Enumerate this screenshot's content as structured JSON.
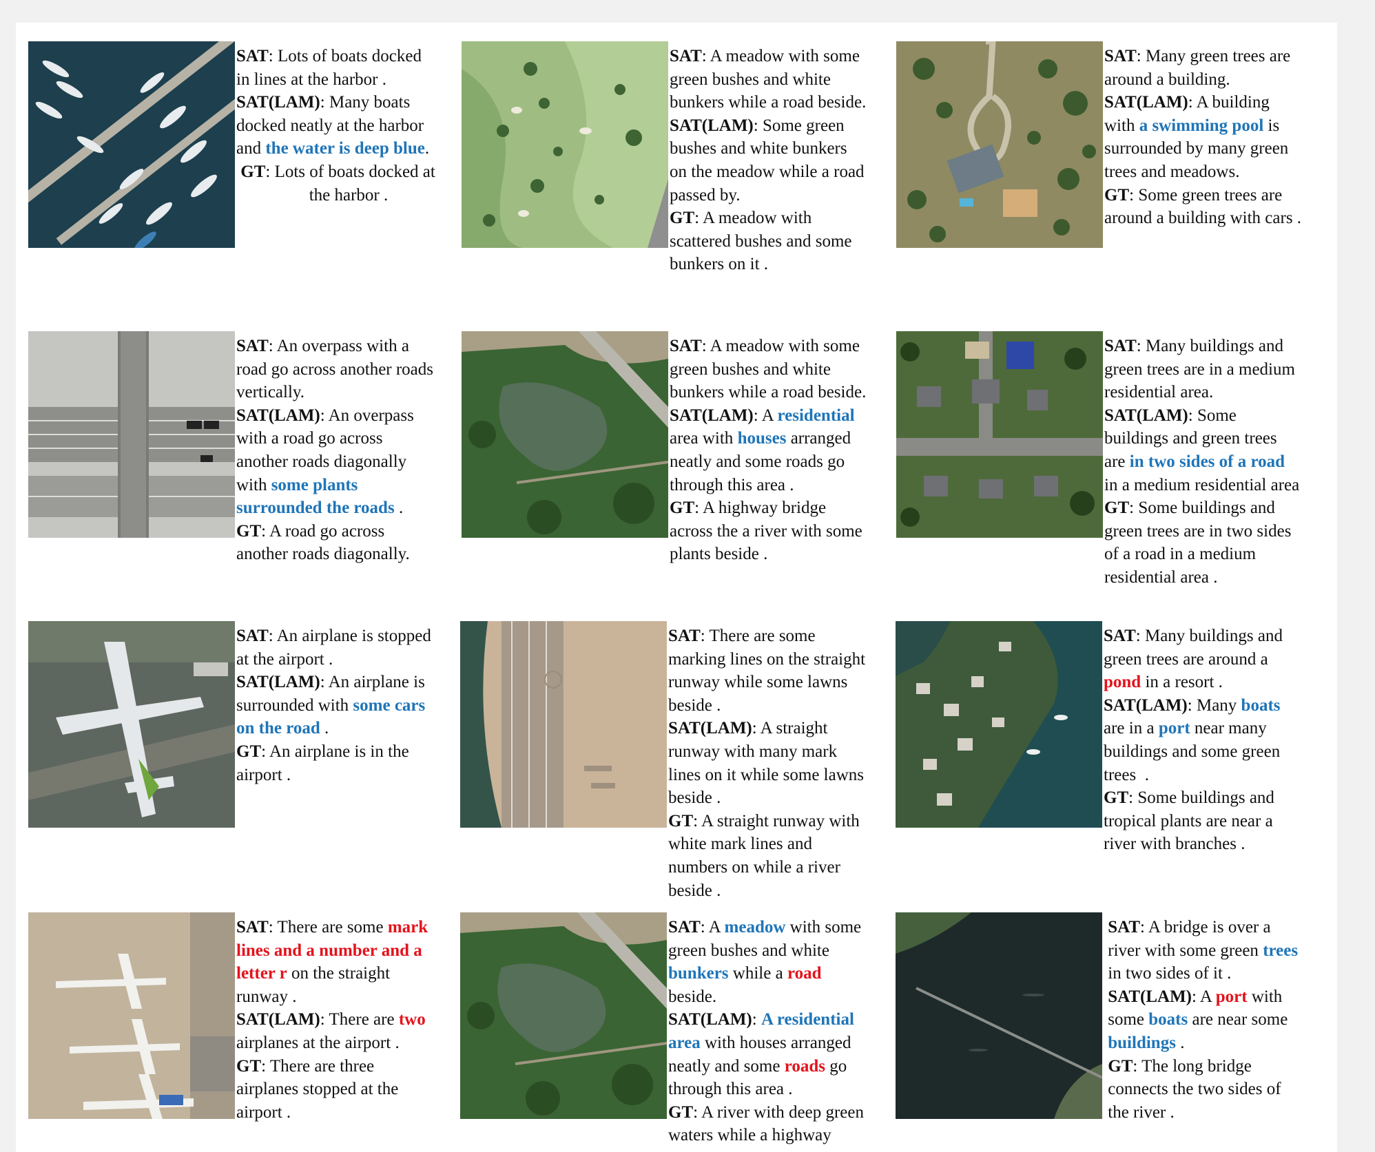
{
  "image_colors": {
    "water": "#1d3f4e",
    "grass": "#9fbd82",
    "forest": "#2f5a2b",
    "road": "#9a9a9a",
    "tarmac": "#c9b49a",
    "dark_water": "#1e2a2a"
  },
  "highlight_colors": {
    "blue": "#1f75b8",
    "red": "#e3131c"
  },
  "examples": [
    {
      "image": "harbor-boats",
      "lines": [
        [
          [
            "b",
            "SAT"
          ],
          [
            "t",
            ": Lots of boats docked"
          ]
        ],
        [
          [
            "t",
            "in lines at the harbor ."
          ]
        ],
        [
          [
            "b",
            "SAT(LAM)"
          ],
          [
            "t",
            ": Many boats"
          ]
        ],
        [
          [
            "t",
            "docked neatly at the harbor"
          ]
        ],
        [
          [
            "t",
            "and "
          ],
          [
            "blue",
            "the water is deep blue"
          ],
          [
            "t",
            "."
          ]
        ],
        [
          [
            "t",
            " "
          ],
          [
            "b",
            "GT"
          ],
          [
            "t",
            ": Lots of boats docked at"
          ]
        ],
        [
          [
            "c",
            "the harbor ."
          ]
        ]
      ]
    },
    {
      "image": "golf-meadow",
      "lines": [
        [
          [
            "b",
            "SAT"
          ],
          [
            "t",
            ": A meadow with some"
          ]
        ],
        [
          [
            "t",
            "green bushes and white"
          ]
        ],
        [
          [
            "t",
            "bunkers while a road beside."
          ]
        ],
        [
          [
            "b",
            "SAT(LAM)"
          ],
          [
            "t",
            ": Some green"
          ]
        ],
        [
          [
            "t",
            "bushes and white bunkers"
          ]
        ],
        [
          [
            "t",
            "on the meadow while a road"
          ]
        ],
        [
          [
            "t",
            "passed by."
          ]
        ],
        [
          [
            "b",
            "GT"
          ],
          [
            "t",
            ": A meadow with"
          ]
        ],
        [
          [
            "t",
            "scattered bushes and some"
          ]
        ],
        [
          [
            "t",
            "bunkers on it ."
          ]
        ]
      ]
    },
    {
      "image": "house-pool",
      "lines": [
        [
          [
            "b",
            "SAT"
          ],
          [
            "t",
            ": Many green trees are"
          ]
        ],
        [
          [
            "t",
            "around a building."
          ]
        ],
        [
          [
            "b",
            "SAT(LAM)"
          ],
          [
            "t",
            ": A building"
          ]
        ],
        [
          [
            "t",
            "with "
          ],
          [
            "blue",
            "a swimming pool"
          ],
          [
            "t",
            " is"
          ]
        ],
        [
          [
            "t",
            "surrounded by many green"
          ]
        ],
        [
          [
            "t",
            "trees and meadows."
          ]
        ],
        [
          [
            "b",
            "GT"
          ],
          [
            "t",
            ": Some green trees are"
          ]
        ],
        [
          [
            "t",
            "around a building with cars ."
          ]
        ]
      ]
    },
    {
      "image": "overpass",
      "lines": [
        [
          [
            "b",
            "SAT"
          ],
          [
            "t",
            ": An overpass with a"
          ]
        ],
        [
          [
            "t",
            "road go across another roads"
          ]
        ],
        [
          [
            "t",
            "vertically."
          ]
        ],
        [
          [
            "b",
            "SAT(LAM)"
          ],
          [
            "t",
            ": An overpass"
          ]
        ],
        [
          [
            "t",
            "with a road go across"
          ]
        ],
        [
          [
            "t",
            "another roads diagonally"
          ]
        ],
        [
          [
            "t",
            "with "
          ],
          [
            "blue",
            "some plants"
          ]
        ],
        [
          [
            "blue",
            "surrounded the roads"
          ],
          [
            "t",
            " ."
          ]
        ],
        [
          [
            "b",
            "GT"
          ],
          [
            "t",
            ": A road go across"
          ]
        ],
        [
          [
            "t",
            "another roads diagonally."
          ]
        ]
      ]
    },
    {
      "image": "river-highway",
      "lines": [
        [
          [
            "b",
            "SAT"
          ],
          [
            "t",
            ": A meadow with some"
          ]
        ],
        [
          [
            "t",
            "green bushes and white"
          ]
        ],
        [
          [
            "t",
            "bunkers while a road beside."
          ]
        ],
        [
          [
            "b",
            "SAT(LAM)"
          ],
          [
            "t",
            ": A "
          ],
          [
            "blue",
            "residential"
          ]
        ],
        [
          [
            "t",
            "area with "
          ],
          [
            "blue",
            "houses"
          ],
          [
            "t",
            " arranged"
          ]
        ],
        [
          [
            "t",
            "neatly and some roads go"
          ]
        ],
        [
          [
            "t",
            "through this area ."
          ]
        ],
        [
          [
            "b",
            "GT"
          ],
          [
            "t",
            ": A highway bridge"
          ]
        ],
        [
          [
            "t",
            "across the a river with some"
          ]
        ],
        [
          [
            "t",
            "plants beside ."
          ]
        ]
      ]
    },
    {
      "image": "residential",
      "lines": [
        [
          [
            "b",
            "SAT"
          ],
          [
            "t",
            ": Many buildings and"
          ]
        ],
        [
          [
            "t",
            "green trees are in a medium"
          ]
        ],
        [
          [
            "t",
            "residential area."
          ]
        ],
        [
          [
            "b",
            "SAT(LAM)"
          ],
          [
            "t",
            ": Some"
          ]
        ],
        [
          [
            "t",
            "buildings and green trees"
          ]
        ],
        [
          [
            "t",
            "are "
          ],
          [
            "blue",
            "in two sides of a road"
          ]
        ],
        [
          [
            "t",
            "in a medium residential area"
          ]
        ],
        [
          [
            "b",
            "GT"
          ],
          [
            "t",
            ": Some buildings and"
          ]
        ],
        [
          [
            "t",
            "green trees are in two sides"
          ]
        ],
        [
          [
            "t",
            "of a road in a medium"
          ]
        ],
        [
          [
            "t",
            "residential area ."
          ]
        ]
      ]
    },
    {
      "image": "airplane",
      "lines": [
        [
          [
            "b",
            "SAT"
          ],
          [
            "t",
            ": An airplane is stopped"
          ]
        ],
        [
          [
            "t",
            "at the airport ."
          ]
        ],
        [
          [
            "b",
            "SAT(LAM)"
          ],
          [
            "t",
            ": An airplane is"
          ]
        ],
        [
          [
            "t",
            "surrounded with "
          ],
          [
            "blue",
            "some cars"
          ]
        ],
        [
          [
            "blue",
            "on the road"
          ],
          [
            "t",
            " ."
          ]
        ],
        [
          [
            "b",
            "GT"
          ],
          [
            "t",
            ": An airplane is in the"
          ]
        ],
        [
          [
            "t",
            "airport ."
          ]
        ]
      ]
    },
    {
      "image": "runway",
      "lines": [
        [
          [
            "b",
            "SAT"
          ],
          [
            "t",
            ": There are some"
          ]
        ],
        [
          [
            "t",
            "marking lines on the straight"
          ]
        ],
        [
          [
            "t",
            "runway while some lawns"
          ]
        ],
        [
          [
            "t",
            "beside ."
          ]
        ],
        [
          [
            "b",
            "SAT(LAM)"
          ],
          [
            "t",
            ": A straight"
          ]
        ],
        [
          [
            "t",
            "runway with many mark"
          ]
        ],
        [
          [
            "t",
            "lines on it while some lawns"
          ]
        ],
        [
          [
            "t",
            "beside ."
          ]
        ],
        [
          [
            "b",
            "GT"
          ],
          [
            "t",
            ": A straight runway with"
          ]
        ],
        [
          [
            "t",
            "white mark lines and"
          ]
        ],
        [
          [
            "t",
            "numbers on while a river"
          ]
        ],
        [
          [
            "t",
            "beside ."
          ]
        ]
      ]
    },
    {
      "image": "resort-river",
      "lines": [
        [
          [
            "b",
            "SAT"
          ],
          [
            "t",
            ": Many buildings and"
          ]
        ],
        [
          [
            "t",
            "green trees are around a"
          ]
        ],
        [
          [
            "red",
            "pond"
          ],
          [
            "t",
            " in a resort ."
          ]
        ],
        [
          [
            "b",
            "SAT(LAM)"
          ],
          [
            "t",
            ": Many "
          ],
          [
            "blue",
            "boats"
          ]
        ],
        [
          [
            "t",
            "are in a "
          ],
          [
            "blue",
            "port"
          ],
          [
            "t",
            " near many"
          ]
        ],
        [
          [
            "t",
            "buildings and some green"
          ]
        ],
        [
          [
            "t",
            "trees  ."
          ]
        ],
        [
          [
            "b",
            "GT"
          ],
          [
            "t",
            ": Some buildings and"
          ]
        ],
        [
          [
            "t",
            "tropical plants are near a"
          ]
        ],
        [
          [
            "t",
            "river with branches ."
          ]
        ]
      ]
    },
    {
      "image": "airport-planes",
      "lines": [
        [
          [
            "b",
            "SAT"
          ],
          [
            "t",
            ": There are some "
          ],
          [
            "red",
            "mark"
          ]
        ],
        [
          [
            "red",
            "lines and a number and a"
          ]
        ],
        [
          [
            "red",
            "letter r"
          ],
          [
            "t",
            " on the straight"
          ]
        ],
        [
          [
            "t",
            "runway ."
          ]
        ],
        [
          [
            "b",
            "SAT(LAM)"
          ],
          [
            "t",
            ": There are "
          ],
          [
            "red",
            "two"
          ]
        ],
        [
          [
            "t",
            "airplanes at the airport ."
          ]
        ],
        [
          [
            "b",
            "GT"
          ],
          [
            "t",
            ": There are three"
          ]
        ],
        [
          [
            "t",
            "airplanes stopped at the"
          ]
        ],
        [
          [
            "t",
            "airport ."
          ]
        ]
      ]
    },
    {
      "image": "river-highway-2",
      "lines": [
        [
          [
            "b",
            "SAT"
          ],
          [
            "t",
            ": A "
          ],
          [
            "blue",
            "meadow"
          ],
          [
            "t",
            " with some"
          ]
        ],
        [
          [
            "t",
            "green bushes and white"
          ]
        ],
        [
          [
            "blue",
            "bunkers"
          ],
          [
            "t",
            " while a "
          ],
          [
            "red",
            "road"
          ]
        ],
        [
          [
            "t",
            "beside."
          ]
        ],
        [
          [
            "b",
            "SAT(LAM)"
          ],
          [
            "t",
            ": "
          ],
          [
            "blue",
            "A residential"
          ]
        ],
        [
          [
            "blue",
            "area"
          ],
          [
            "t",
            " with houses arranged"
          ]
        ],
        [
          [
            "t",
            "neatly and some "
          ],
          [
            "red",
            "roads"
          ],
          [
            "t",
            " go"
          ]
        ],
        [
          [
            "t",
            "through this area ."
          ]
        ],
        [
          [
            "b",
            "GT"
          ],
          [
            "t",
            ": A river with deep green"
          ]
        ],
        [
          [
            "t",
            "waters while a highway"
          ]
        ]
      ]
    },
    {
      "image": "bridge-river",
      "lines": [
        [
          [
            "t",
            " "
          ],
          [
            "b",
            "SAT"
          ],
          [
            "t",
            ": A bridge is over a"
          ]
        ],
        [
          [
            "t",
            " river with some green "
          ],
          [
            "blue",
            "trees"
          ]
        ],
        [
          [
            "t",
            " in two sides of it ."
          ]
        ],
        [
          [
            "t",
            " "
          ],
          [
            "b",
            "SAT(LAM)"
          ],
          [
            "t",
            ": A "
          ],
          [
            "red",
            "port"
          ],
          [
            "t",
            " with"
          ]
        ],
        [
          [
            "t",
            " some "
          ],
          [
            "blue",
            "boats"
          ],
          [
            "t",
            " are near some"
          ]
        ],
        [
          [
            "t",
            " "
          ],
          [
            "blue",
            "buildings"
          ],
          [
            "t",
            " ."
          ]
        ],
        [
          [
            "t",
            " "
          ],
          [
            "b",
            "GT"
          ],
          [
            "t",
            ": The long bridge"
          ]
        ],
        [
          [
            "t",
            " connects the two sides of"
          ]
        ],
        [
          [
            "t",
            " the river ."
          ]
        ]
      ]
    }
  ]
}
